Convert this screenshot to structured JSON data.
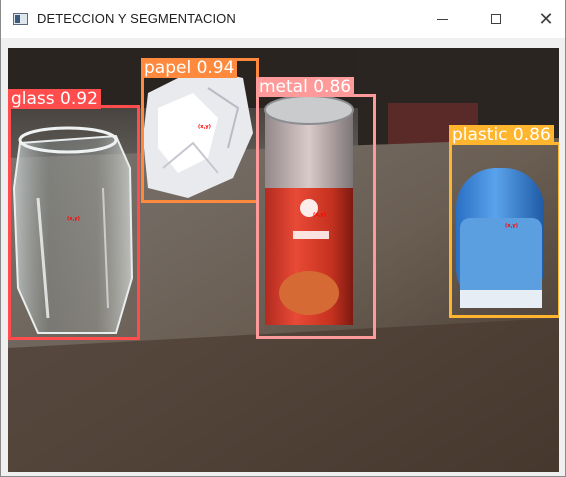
{
  "window": {
    "title": "DETECCION Y SEGMENTACION",
    "minimize_icon": "minimize-icon",
    "maximize_icon": "maximize-icon",
    "close_icon": "close-icon",
    "close_glyph": "✕"
  },
  "detections": [
    {
      "label": "glass 0.92",
      "color": "#ff4d4d",
      "center_text": "(x,y)"
    },
    {
      "label": "papel 0.94",
      "color": "#ff8a3d",
      "center_text": "(x,y)"
    },
    {
      "label": "metal 0.86",
      "color": "#ff9a9a",
      "center_text": "(x,y)"
    },
    {
      "label": "plastic 0.86",
      "color": "#ffb52e",
      "center_text": "(x,y)"
    }
  ]
}
